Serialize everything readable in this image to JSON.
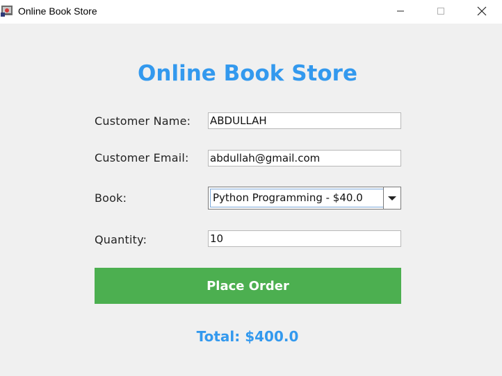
{
  "window": {
    "title": "Online Book Store",
    "icons": {
      "app": "java-app-icon",
      "minimize": "minimize-icon",
      "maximize": "maximize-icon",
      "close": "close-icon"
    }
  },
  "form": {
    "heading": "Online Book Store",
    "customer_name": {
      "label": "Customer Name:",
      "value": "ABDULLAH"
    },
    "customer_email": {
      "label": "Customer Email:",
      "value": "abdullah@gmail.com"
    },
    "book": {
      "label": "Book:",
      "selected": "Python Programming - $40.0"
    },
    "quantity": {
      "label": "Quantity:",
      "value": "10"
    },
    "submit_label": "Place Order",
    "total": "Total: $400.0"
  },
  "colors": {
    "accent_blue": "#3399ee",
    "button_green": "#4caf50",
    "background": "#f0f0f0"
  }
}
